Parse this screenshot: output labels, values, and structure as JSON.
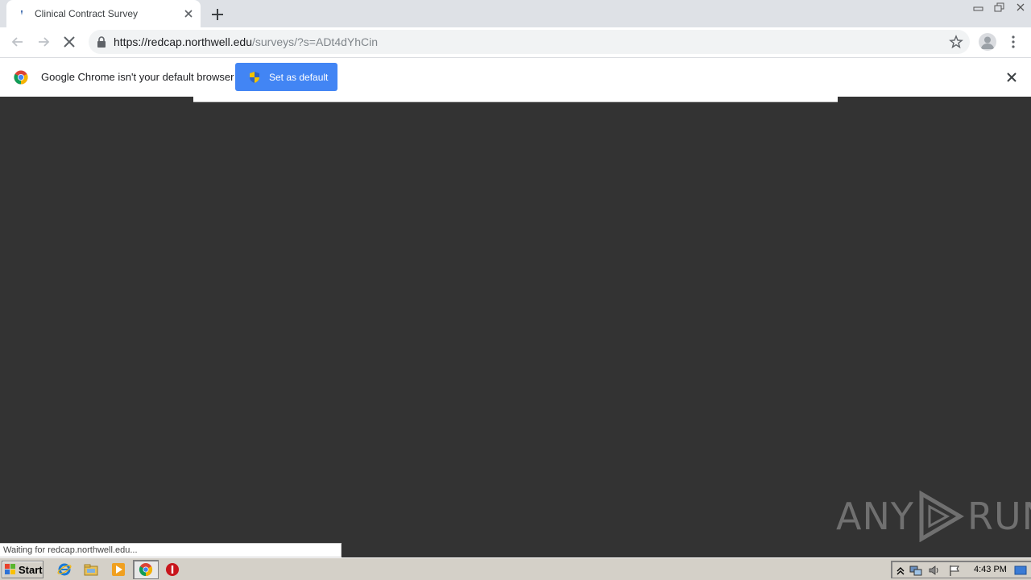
{
  "tab": {
    "title": "Clinical Contract Survey"
  },
  "toolbar": {
    "url_host": "https://redcap.northwell.edu",
    "url_path": "/surveys/?s=ADt4dYhCin"
  },
  "infobar": {
    "message": "Google Chrome isn't your default browser",
    "button_label": "Set as default"
  },
  "status": {
    "text": "Waiting for redcap.northwell.edu..."
  },
  "watermark": {
    "left": "ANY",
    "right": "RUN"
  },
  "taskbar": {
    "start_label": "Start",
    "clock": "4:43 PM"
  },
  "colors": {
    "accent": "#4285f4",
    "page_bg": "#333333",
    "tabstrip_bg": "#dee1e6"
  },
  "icons": {
    "tab_favicon": "redcap-favicon",
    "tab_close": "close-icon",
    "new_tab": "plus-icon",
    "back": "arrow-left-icon",
    "forward": "arrow-right-icon",
    "stop": "stop-icon",
    "lock": "lock-icon",
    "bookmark": "star-icon",
    "profile": "avatar-icon",
    "menu": "kebab-menu-icon",
    "chrome": "chrome-logo-icon",
    "shield": "uac-shield-icon",
    "infobar_close": "close-icon"
  }
}
